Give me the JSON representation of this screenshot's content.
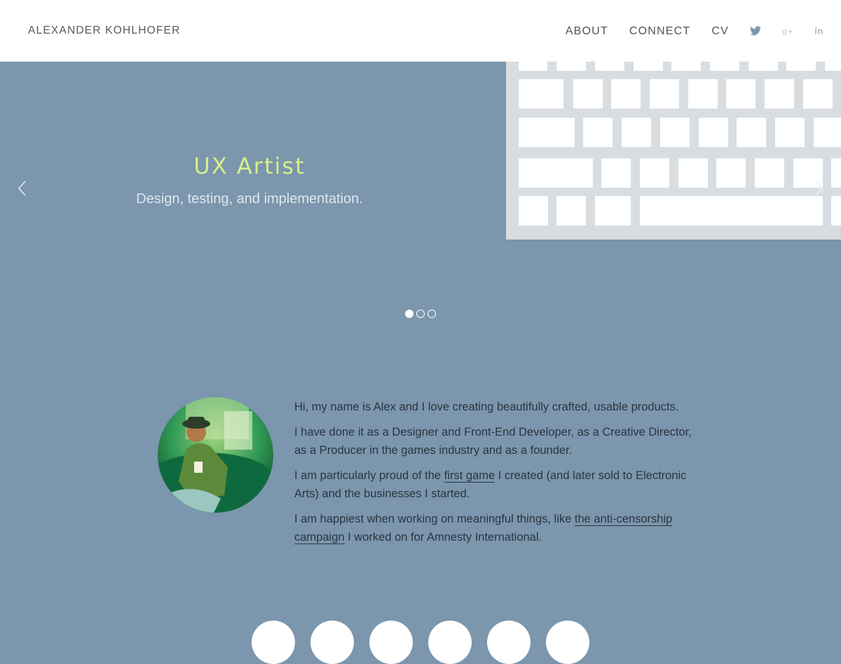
{
  "header": {
    "brand": "ALEXANDER KOHLHOFER",
    "nav": [
      {
        "label": "ABOUT"
      },
      {
        "label": "CONNECT"
      },
      {
        "label": "CV"
      }
    ],
    "social_icons": [
      "twitter-icon",
      "google-plus-icon",
      "linkedin-icon"
    ]
  },
  "hero": {
    "slide": {
      "title": "UX Artist",
      "subtitle": "Design, testing, and implementation."
    },
    "slide_count": 3,
    "active_slide": 1
  },
  "about": {
    "paragraphs": {
      "p1": "Hi, my name is Alex and I love creating beautifully crafted, usable products.",
      "p2": "I have done it as a Designer and Front-End Developer, as a Creative Director, as a Producer in the games industry and as a founder.",
      "p3_before": "I am particularly proud of the ",
      "p3_link": "first game",
      "p3_after": " I created (and later sold to Electronic Arts) and the businesses I started.",
      "p4_before": "I am happiest when working on meaningful things, like ",
      "p4_link": "the anti-censorship campaign",
      "p4_after": " I worked on for Amnesty International."
    }
  },
  "colors": {
    "background": "#7b96ad",
    "header_bg": "#ffffff",
    "title_accent": "#d7ee8a",
    "text_dark": "#2b3540"
  }
}
